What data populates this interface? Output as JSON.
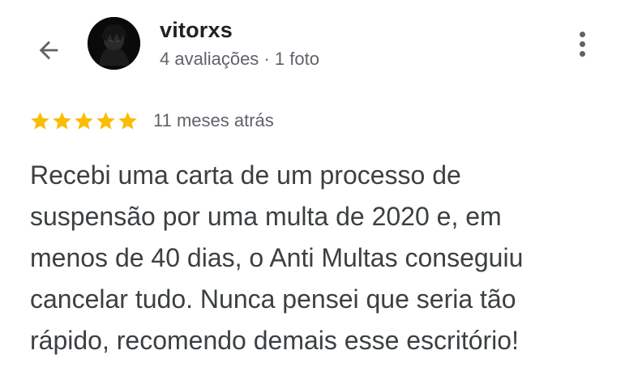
{
  "header": {
    "back_icon": "arrow-left-icon",
    "user_name": "vitorxs",
    "reviews_count": "4 avaliações",
    "separator": "·",
    "photos_count": "1 foto",
    "menu_icon": "more-vert-icon"
  },
  "rating": {
    "stars": 5,
    "star_color": "#fbbc04",
    "time_ago": "11 meses atrás"
  },
  "review": {
    "lines": [
      "Recebi uma carta de um processo de",
      "suspensão por uma multa de 2020 e, em",
      "menos de 40 dias, o Anti Multas conseguiu",
      "cancelar tudo. Nunca pensei que seria tão",
      "rápido, recomendo demais esse escritório!"
    ]
  },
  "colors": {
    "text_primary": "#202124",
    "text_secondary": "#5f6368",
    "review_text": "#3c4043"
  }
}
